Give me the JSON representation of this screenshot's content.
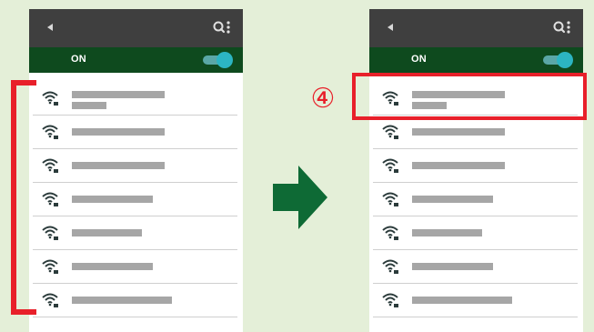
{
  "step": {
    "label": "④"
  },
  "colors": {
    "background": "#e4efd8",
    "toolbar": "#3f3f3f",
    "wifi_bar": "#0e4a1e",
    "toggle": "#2cb5c2",
    "highlight": "#e8202a",
    "arrow": "#0e6a35"
  },
  "screens": [
    {
      "wifi": {
        "state_label": "ON",
        "toggle_on": true
      },
      "networks": [
        {
          "icon": "wifi-lock-icon",
          "name_width": 102,
          "has_subtitle": true
        },
        {
          "icon": "wifi-lock-icon",
          "name_width": 102,
          "has_subtitle": false
        },
        {
          "icon": "wifi-lock-icon",
          "name_width": 102,
          "has_subtitle": false
        },
        {
          "icon": "wifi-lock-icon",
          "name_width": 89,
          "has_subtitle": false
        },
        {
          "icon": "wifi-lock-icon",
          "name_width": 77,
          "has_subtitle": false
        },
        {
          "icon": "wifi-lock-icon",
          "name_width": 89,
          "has_subtitle": false
        },
        {
          "icon": "wifi-lock-icon",
          "name_width": 110,
          "has_subtitle": false
        }
      ]
    },
    {
      "wifi": {
        "state_label": "ON",
        "toggle_on": true
      },
      "networks": [
        {
          "icon": "wifi-lock-icon",
          "name_width": 102,
          "has_subtitle": true
        },
        {
          "icon": "wifi-lock-icon",
          "name_width": 102,
          "has_subtitle": false
        },
        {
          "icon": "wifi-lock-icon",
          "name_width": 102,
          "has_subtitle": false
        },
        {
          "icon": "wifi-lock-icon",
          "name_width": 89,
          "has_subtitle": false
        },
        {
          "icon": "wifi-lock-icon",
          "name_width": 77,
          "has_subtitle": false
        },
        {
          "icon": "wifi-lock-icon",
          "name_width": 89,
          "has_subtitle": false
        },
        {
          "icon": "wifi-lock-icon",
          "name_width": 110,
          "has_subtitle": false
        }
      ]
    }
  ]
}
